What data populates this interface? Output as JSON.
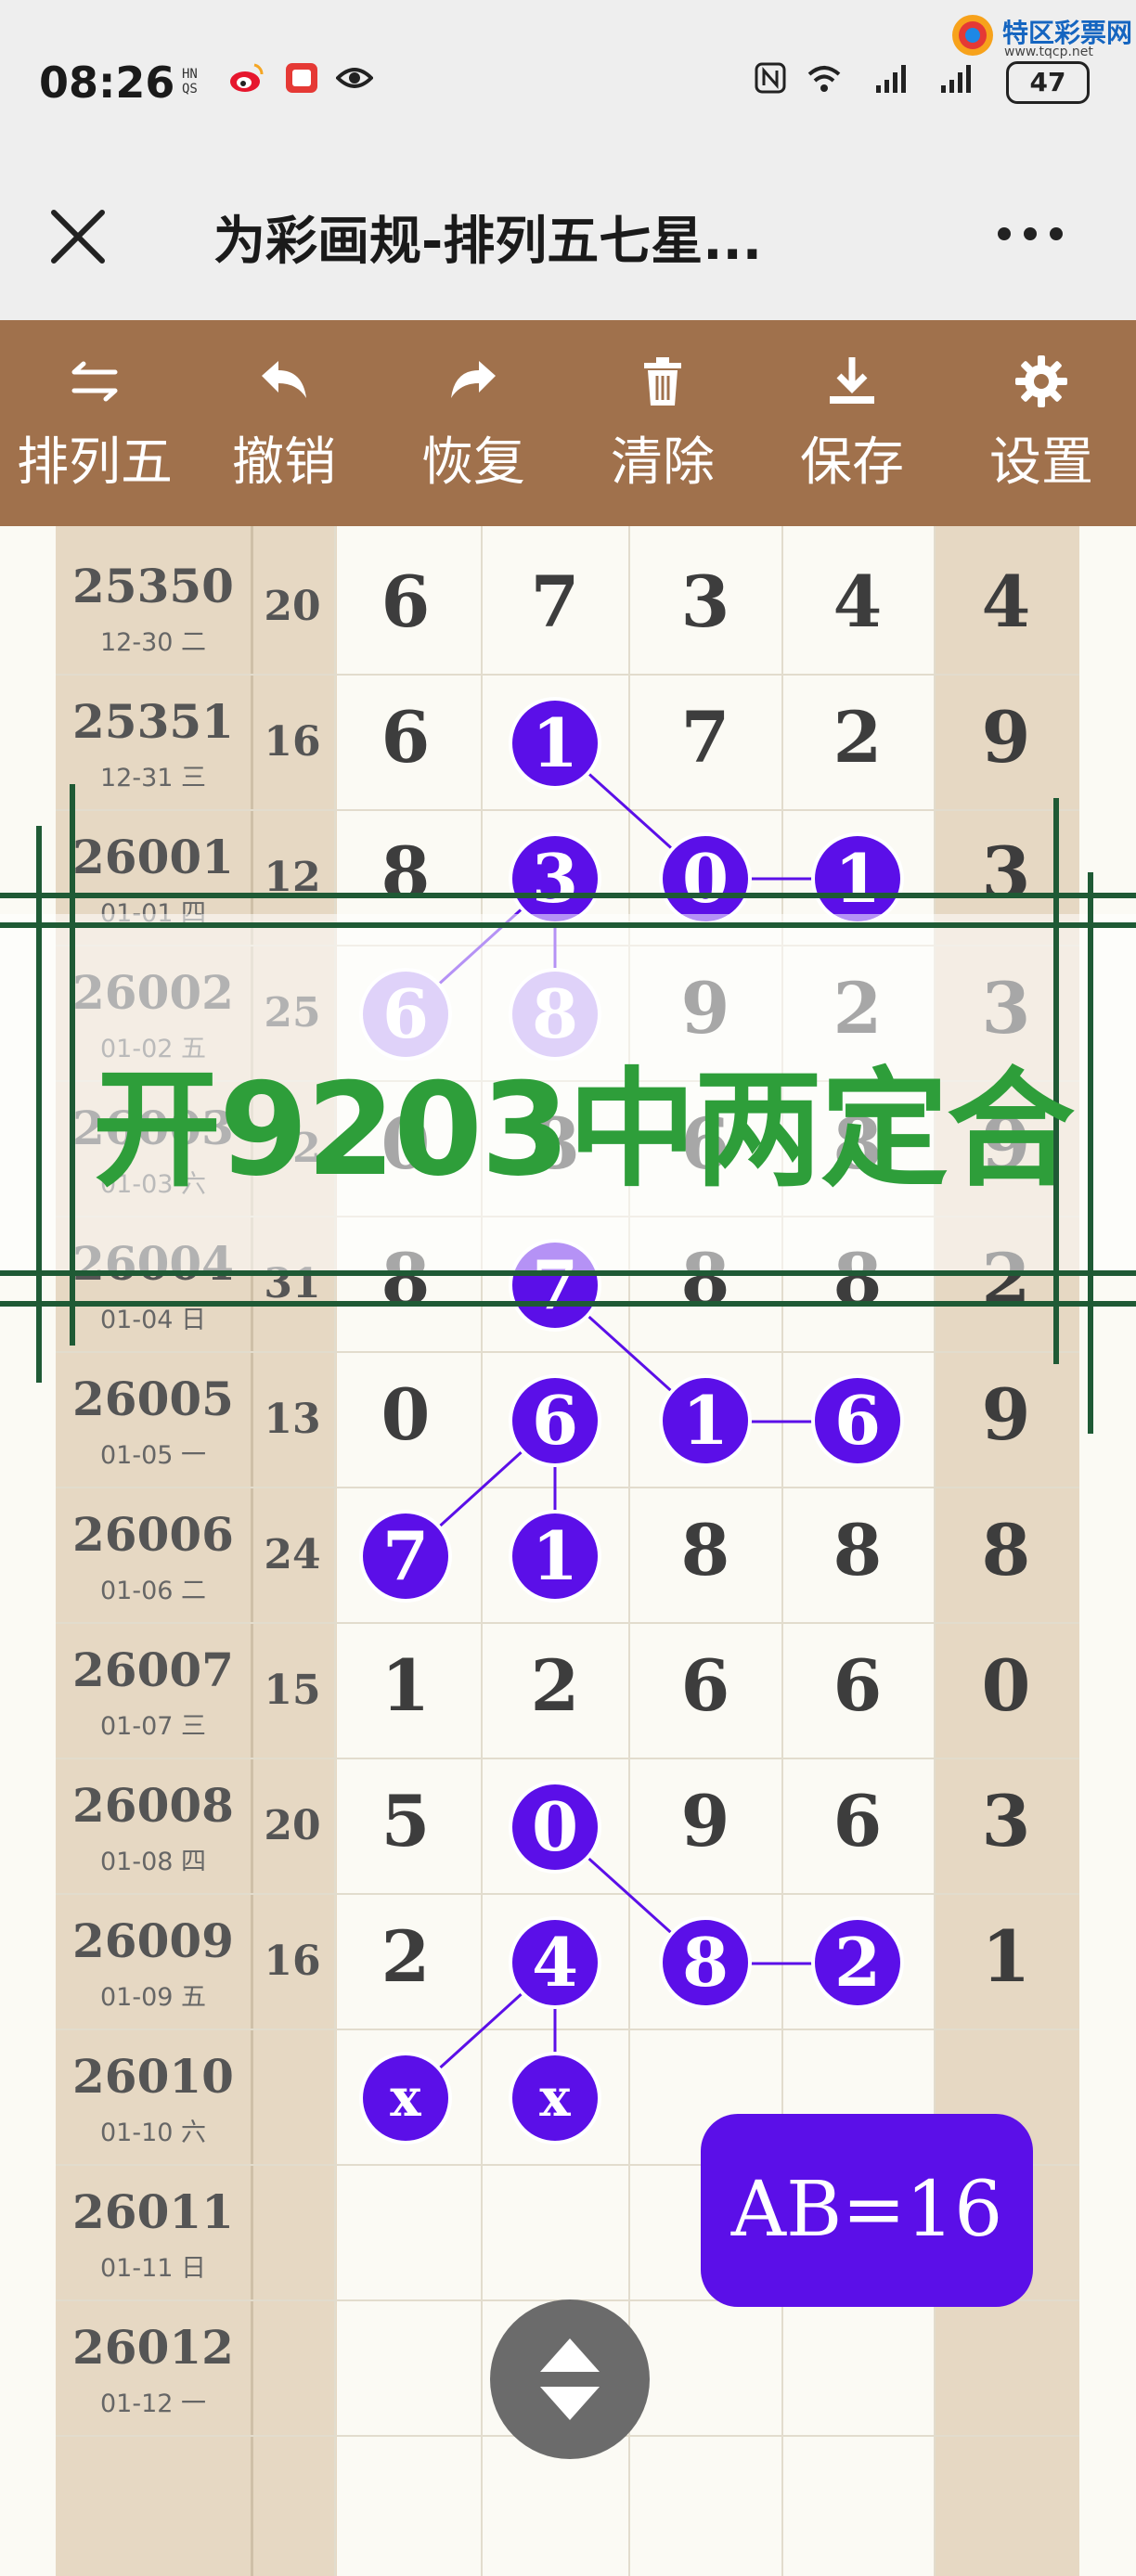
{
  "status_bar": {
    "time": "08:26",
    "small_text": "HN\nQS",
    "battery": "47",
    "icons": [
      "weibo-icon",
      "red-app-icon",
      "eye-icon",
      "nfc-icon",
      "wifi-icon",
      "signal-icon",
      "signal-icon",
      "battery-icon"
    ]
  },
  "watermark": {
    "name": "特区彩票网",
    "url": "www.tqcp.net"
  },
  "header": {
    "title": "为彩画规-排列五七星...",
    "close_icon": "close-icon",
    "more_icon": "more-icon"
  },
  "toolbar": {
    "items": [
      {
        "label": "排列五",
        "icon": "swap-icon"
      },
      {
        "label": "撤销",
        "icon": "undo-icon"
      },
      {
        "label": "恢复",
        "icon": "redo-icon"
      },
      {
        "label": "清除",
        "icon": "trash-icon"
      },
      {
        "label": "保存",
        "icon": "download-icon"
      },
      {
        "label": "设置",
        "icon": "gear-icon"
      }
    ]
  },
  "rows": [
    {
      "issue": "25350",
      "date": "12-30 二",
      "sum": "20",
      "digits": [
        "6",
        "7",
        "3",
        "4",
        "4"
      ]
    },
    {
      "issue": "25351",
      "date": "12-31 三",
      "sum": "16",
      "digits": [
        "6",
        "1",
        "7",
        "2",
        "9"
      ]
    },
    {
      "issue": "26001",
      "date": "01-01 四",
      "sum": "12",
      "digits": [
        "8",
        "3",
        "0",
        "1",
        "3"
      ]
    },
    {
      "issue": "26002",
      "date": "01-02 五",
      "sum": "25",
      "digits": [
        "6",
        "8",
        "9",
        "2",
        "3"
      ]
    },
    {
      "issue": "26003",
      "date": "01-03 六",
      "sum": "22",
      "digits": [
        "0",
        "8",
        "6",
        "8",
        "9"
      ]
    },
    {
      "issue": "26004",
      "date": "01-04 日",
      "sum": "31",
      "digits": [
        "8",
        "7",
        "8",
        "8",
        "2"
      ]
    },
    {
      "issue": "26005",
      "date": "01-05 一",
      "sum": "13",
      "digits": [
        "0",
        "6",
        "1",
        "6",
        "9"
      ]
    },
    {
      "issue": "26006",
      "date": "01-06 二",
      "sum": "24",
      "digits": [
        "7",
        "1",
        "8",
        "8",
        "8"
      ]
    },
    {
      "issue": "26007",
      "date": "01-07 三",
      "sum": "15",
      "digits": [
        "1",
        "2",
        "6",
        "6",
        "0"
      ]
    },
    {
      "issue": "26008",
      "date": "01-08 四",
      "sum": "20",
      "digits": [
        "5",
        "0",
        "9",
        "6",
        "3"
      ]
    },
    {
      "issue": "26009",
      "date": "01-09 五",
      "sum": "16",
      "digits": [
        "2",
        "4",
        "8",
        "2",
        "1"
      ]
    },
    {
      "issue": "26010",
      "date": "01-10 六",
      "sum": "",
      "digits": [
        "x",
        "x",
        "",
        "",
        ""
      ]
    },
    {
      "issue": "26011",
      "date": "01-11 日",
      "sum": "",
      "digits": [
        "",
        "",
        "",
        "",
        ""
      ]
    },
    {
      "issue": "26012",
      "date": "01-12 一",
      "sum": "",
      "digits": [
        "",
        "",
        "",
        "",
        ""
      ]
    }
  ],
  "overlay": {
    "text": "开9203中两定合"
  },
  "badge": {
    "text": "AB=16"
  },
  "scroll_button": {
    "icon": "up-down-arrows-icon"
  }
}
